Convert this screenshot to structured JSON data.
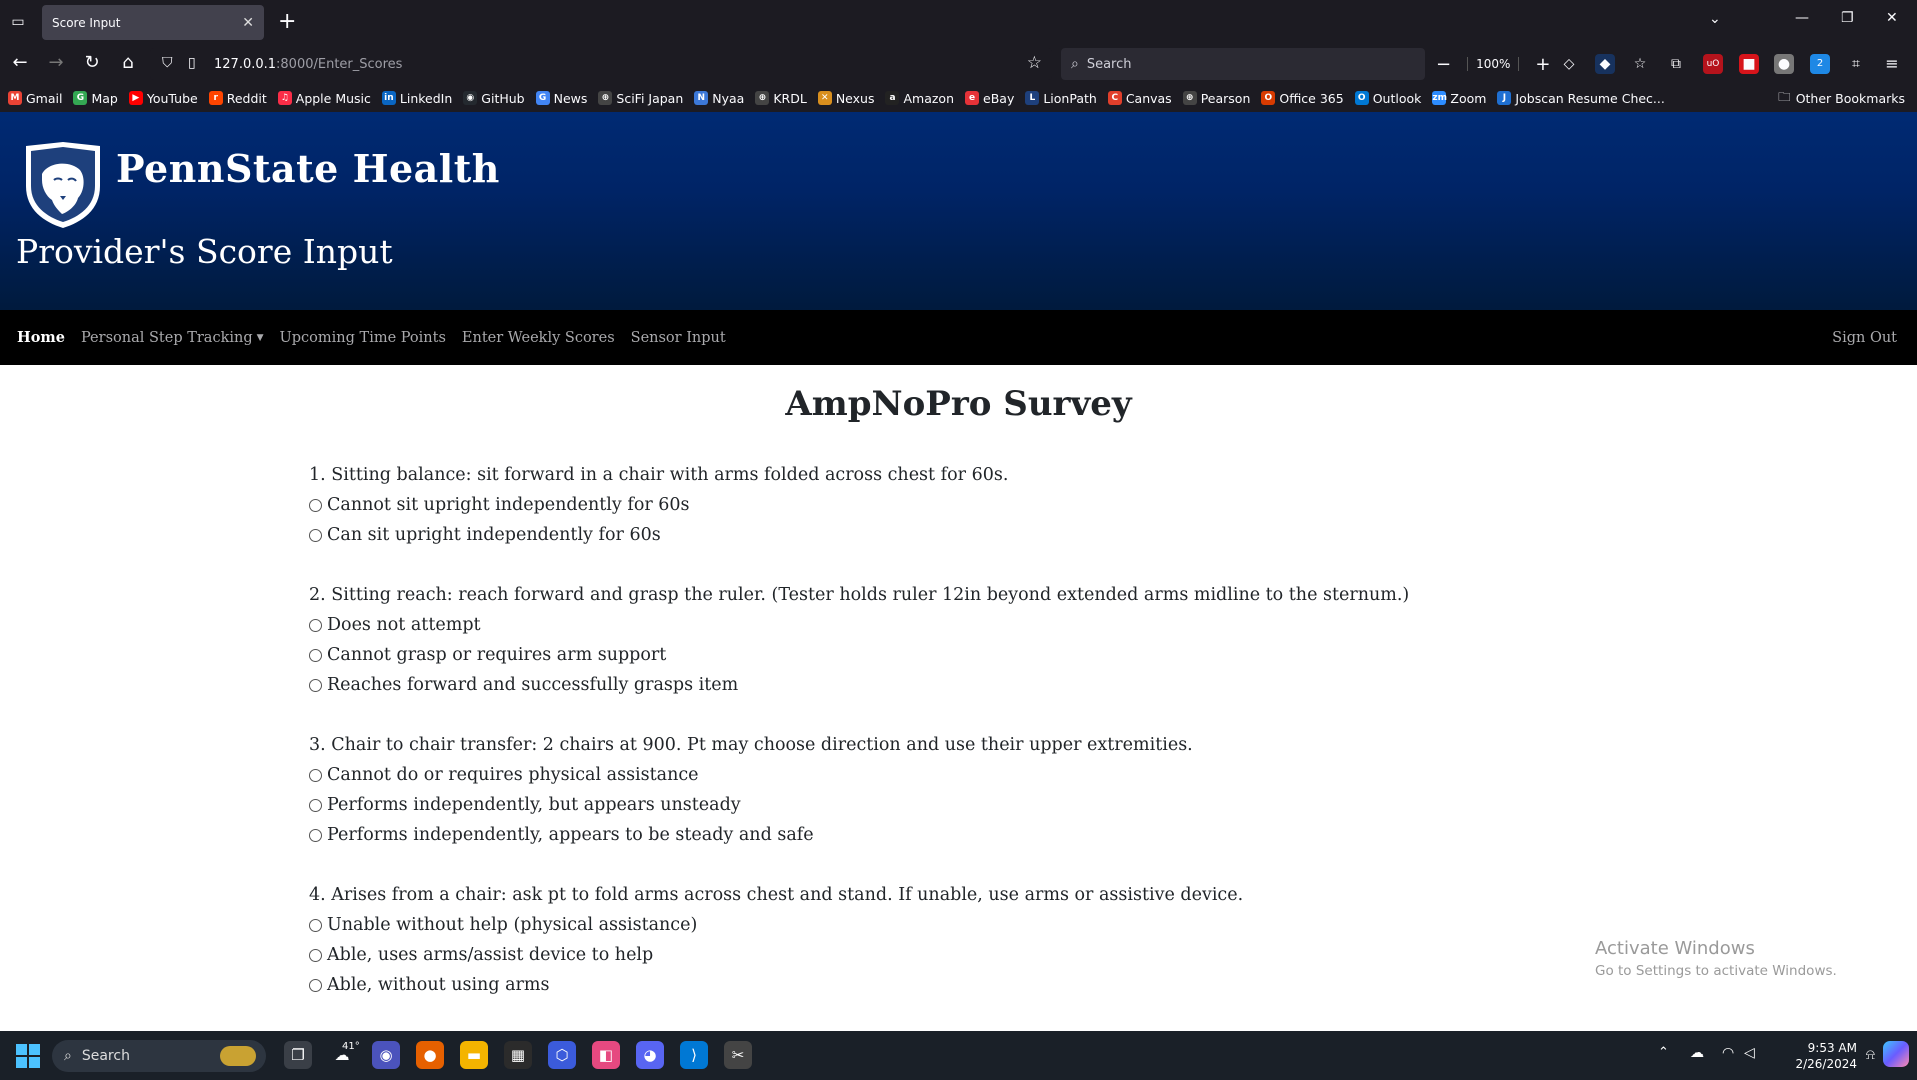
{
  "browser": {
    "tab_title": "Score Input",
    "url_host": "127.0.0.1",
    "url_path": ":8000/Enter_Scores",
    "search_placeholder": "Search",
    "zoom": "100%",
    "bookmarks": [
      {
        "label": "Gmail",
        "color": "#ea4335",
        "glyph": "M"
      },
      {
        "label": "Map",
        "color": "#34a853",
        "glyph": "G"
      },
      {
        "label": "YouTube",
        "color": "#ff0000",
        "glyph": "▶"
      },
      {
        "label": "Reddit",
        "color": "#ff4500",
        "glyph": "r"
      },
      {
        "label": "Apple Music",
        "color": "#fa2d48",
        "glyph": "♫"
      },
      {
        "label": "LinkedIn",
        "color": "#0a66c2",
        "glyph": "in"
      },
      {
        "label": "GitHub",
        "color": "#24292f",
        "glyph": "◉"
      },
      {
        "label": "News",
        "color": "#4285f4",
        "glyph": "G"
      },
      {
        "label": "SciFi Japan",
        "color": "#444",
        "glyph": "⊕"
      },
      {
        "label": "Nyaa",
        "color": "#3c78d8",
        "glyph": "N"
      },
      {
        "label": "KRDL",
        "color": "#444",
        "glyph": "⊕"
      },
      {
        "label": "Nexus",
        "color": "#d98f1e",
        "glyph": "✕"
      },
      {
        "label": "Amazon",
        "color": "#222",
        "glyph": "a"
      },
      {
        "label": "eBay",
        "color": "#e53238",
        "glyph": "e"
      },
      {
        "label": "LionPath",
        "color": "#1e407c",
        "glyph": "L"
      },
      {
        "label": "Canvas",
        "color": "#e13f2b",
        "glyph": "C"
      },
      {
        "label": "Pearson",
        "color": "#444",
        "glyph": "⊕"
      },
      {
        "label": "Office 365",
        "color": "#d83b01",
        "glyph": "O"
      },
      {
        "label": "Outlook",
        "color": "#0078d4",
        "glyph": "O"
      },
      {
        "label": "Zoom",
        "color": "#2d8cff",
        "glyph": "zm"
      },
      {
        "label": "Jobscan Resume Chec...",
        "color": "#1f6fd1",
        "glyph": "J"
      }
    ],
    "other_bookmarks": "Other Bookmarks"
  },
  "header": {
    "brand": "PennState Health",
    "subtitle": "Provider's Score Input"
  },
  "nav": {
    "home": "Home",
    "personal_step_tracking": "Personal Step Tracking",
    "upcoming_time_points": "Upcoming Time Points",
    "enter_weekly_scores": "Enter Weekly Scores",
    "sensor_input": "Sensor Input",
    "sign_out": "Sign Out"
  },
  "survey": {
    "title": "AmpNoPro Survey",
    "questions": [
      {
        "text": "1. Sitting balance: sit forward in a chair with arms folded across chest for 60s.",
        "options": [
          "Cannot sit upright independently for 60s",
          "Can sit upright independently for 60s"
        ]
      },
      {
        "text": "2. Sitting reach: reach forward and grasp the ruler. (Tester holds ruler 12in beyond extended arms midline to the sternum.)",
        "options": [
          "Does not attempt",
          "Cannot grasp or requires arm support",
          "Reaches forward and successfully grasps item"
        ]
      },
      {
        "text": "3. Chair to chair transfer: 2 chairs at 900. Pt may choose direction and use their upper extremities.",
        "options": [
          "Cannot do or requires physical assistance",
          "Performs independently, but appears unsteady",
          "Performs independently, appears to be steady and safe"
        ]
      },
      {
        "text": "4. Arises from a chair: ask pt to fold arms across chest and stand. If unable, use arms or assistive device.",
        "options": [
          "Unable without help (physical assistance)",
          "Able, uses arms/assist device to help",
          "Able, without using arms"
        ]
      }
    ]
  },
  "watermark": {
    "line1": "Activate Windows",
    "line2": "Go to Settings to activate Windows."
  },
  "taskbar": {
    "search": "Search",
    "weather": "41°",
    "time": "9:53 AM",
    "date": "2/26/2024"
  }
}
